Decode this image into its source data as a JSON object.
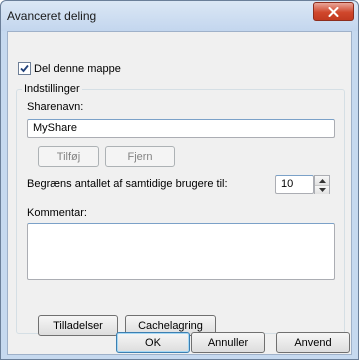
{
  "window": {
    "title": "Avanceret deling",
    "close_label": "x"
  },
  "share_checkbox": {
    "label": "Del denne mappe",
    "checked": true
  },
  "settings": {
    "legend": "Indstillinger",
    "share_name_label": "Sharenavn:",
    "share_name_value": "MyShare",
    "add_button": "Tilføj",
    "remove_button": "Fjern",
    "limit_label": "Begræns antallet af samtidige brugere til:",
    "limit_value": "10",
    "comment_label": "Kommentar:",
    "comment_value": "",
    "permissions_button": "Tilladelser",
    "caching_button": "Cachelagring"
  },
  "footer": {
    "ok_button": "OK",
    "cancel_button": "Annuller",
    "apply_button": "Anvend"
  },
  "colors": {
    "frame": "#c6d9ef",
    "client": "#f0f0f0",
    "close_button": "#d0472c",
    "focus_border": "#7ba1c8"
  }
}
